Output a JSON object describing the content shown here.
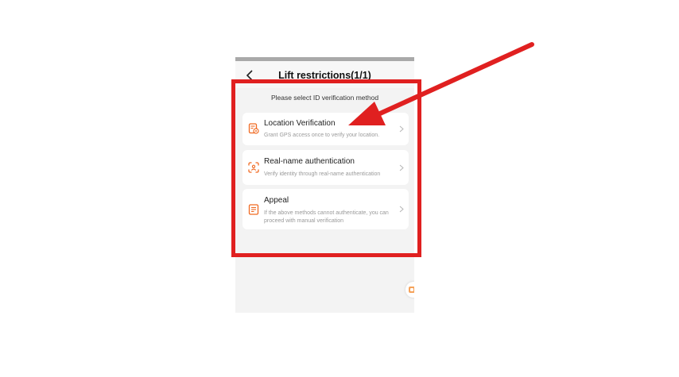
{
  "header": {
    "title": "Lift restrictions(1/1)"
  },
  "prompt": "Please select ID verification method",
  "options": [
    {
      "title": "Location Verification",
      "description": "Grant GPS access once to verify your location.",
      "icon": "location-doc-icon"
    },
    {
      "title": "Real-name authentication",
      "description": "Verify identity through real-name authentication",
      "icon": "face-scan-icon"
    },
    {
      "title": "Appeal",
      "description": "If the above methods cannot authenticate, you can proceed with manual verification",
      "icon": "appeal-doc-icon"
    }
  ],
  "colors": {
    "accent": "#f06a22",
    "annotation": "#e02020",
    "background": "#f3f3f3"
  }
}
